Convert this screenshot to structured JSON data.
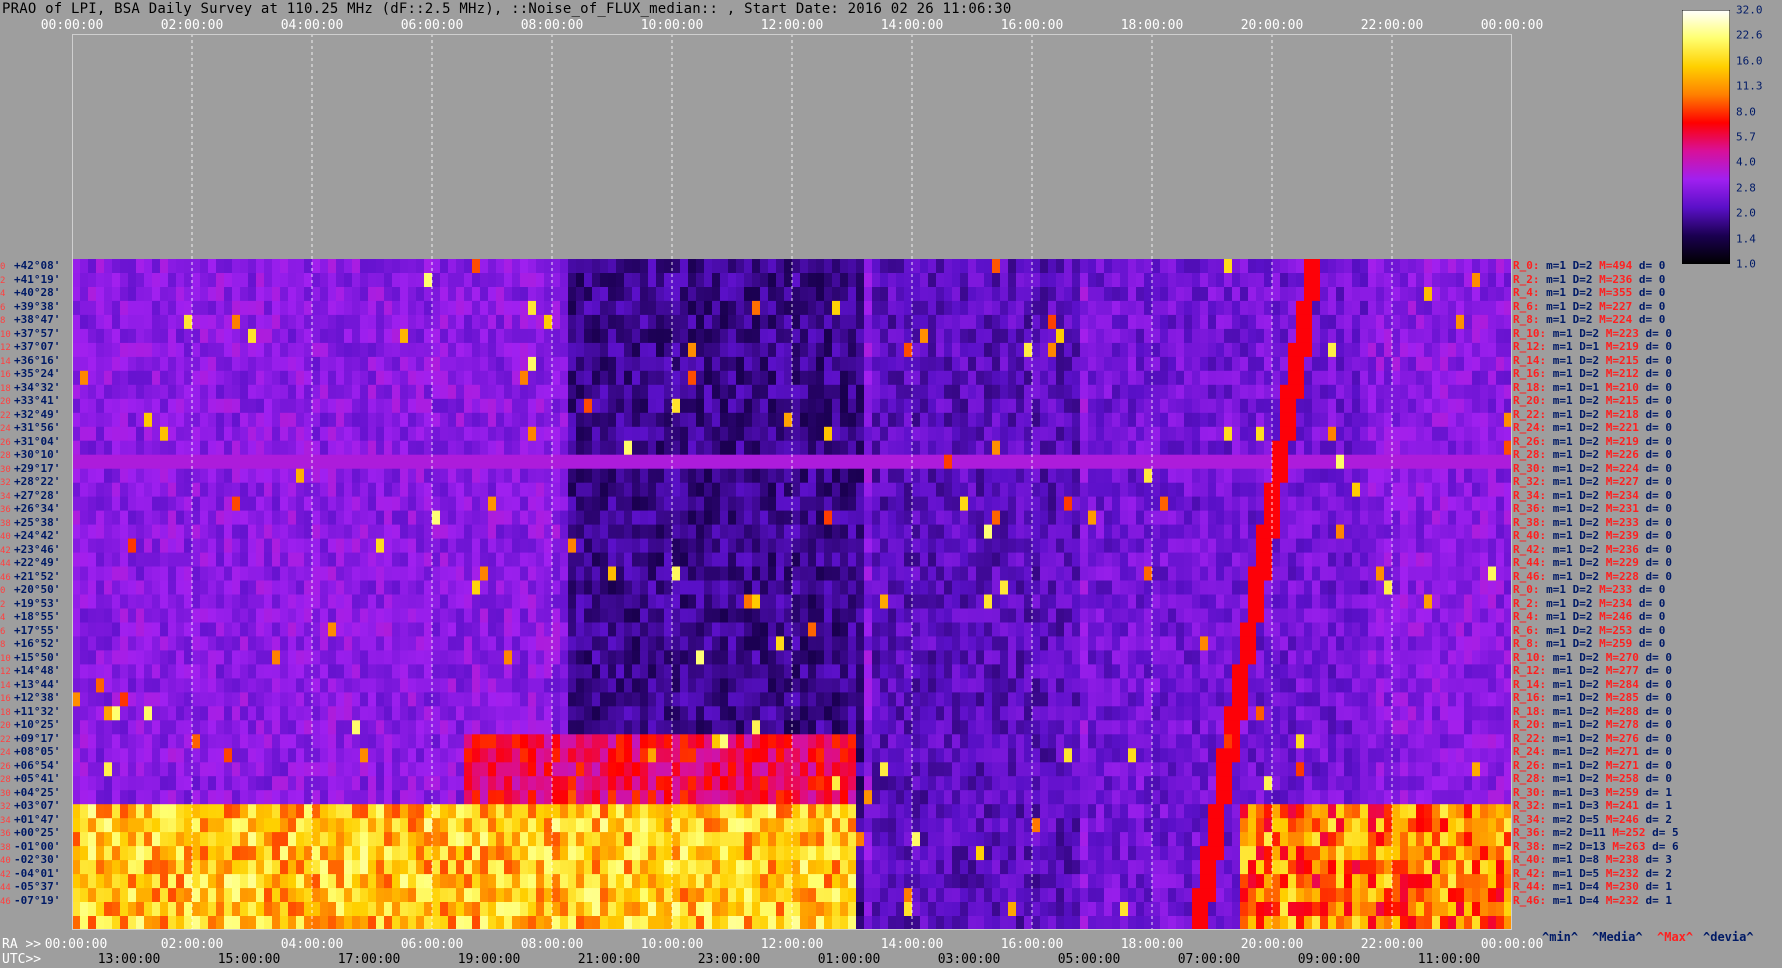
{
  "title": "PRAO of LPI, BSA Daily Survey at 110.25 MHz (dF::2.5 MHz), ::Noise_of_FLUX_median:: , Start Date: 2016 02 26 11:06:30",
  "top_axis": [
    "00:00:00",
    "02:00:00",
    "04:00:00",
    "06:00:00",
    "08:00:00",
    "10:00:00",
    "12:00:00",
    "14:00:00",
    "16:00:00",
    "18:00:00",
    "20:00:00",
    "22:00:00",
    "00:00:00"
  ],
  "bottom_axis_prefix": "RA >>",
  "bottom_axis": [
    "00:00:00",
    "02:00:00",
    "04:00:00",
    "06:00:00",
    "08:00:00",
    "10:00:00",
    "12:00:00",
    "14:00:00",
    "16:00:00",
    "18:00:00",
    "20:00:00",
    "22:00:00",
    "00:00:00"
  ],
  "utc_prefix": "UTC>>",
  "utc_axis": [
    "13:00:00",
    "15:00:00",
    "17:00:00",
    "19:00:00",
    "21:00:00",
    "23:00:00",
    "01:00:00",
    "03:00:00",
    "05:00:00",
    "07:00:00",
    "09:00:00",
    "11:00:00"
  ],
  "declinations": [
    {
      "idx": "0",
      "dec": "+42°08'"
    },
    {
      "idx": "2",
      "dec": "+41°19'"
    },
    {
      "idx": "4",
      "dec": "+40°28'"
    },
    {
      "idx": "6",
      "dec": "+39°38'"
    },
    {
      "idx": "8",
      "dec": "+38°47'"
    },
    {
      "idx": "10",
      "dec": "+37°57'"
    },
    {
      "idx": "12",
      "dec": "+37°07'"
    },
    {
      "idx": "14",
      "dec": "+36°16'"
    },
    {
      "idx": "16",
      "dec": "+35°24'"
    },
    {
      "idx": "18",
      "dec": "+34°32'"
    },
    {
      "idx": "20",
      "dec": "+33°41'"
    },
    {
      "idx": "22",
      "dec": "+32°49'"
    },
    {
      "idx": "24",
      "dec": "+31°56'"
    },
    {
      "idx": "26",
      "dec": "+31°04'"
    },
    {
      "idx": "28",
      "dec": "+30°10'"
    },
    {
      "idx": "30",
      "dec": "+29°17'"
    },
    {
      "idx": "32",
      "dec": "+28°22'"
    },
    {
      "idx": "34",
      "dec": "+27°28'"
    },
    {
      "idx": "36",
      "dec": "+26°34'"
    },
    {
      "idx": "38",
      "dec": "+25°38'"
    },
    {
      "idx": "40",
      "dec": "+24°42'"
    },
    {
      "idx": "42",
      "dec": "+23°46'"
    },
    {
      "idx": "44",
      "dec": "+22°49'"
    },
    {
      "idx": "46",
      "dec": "+21°52'"
    },
    {
      "idx": "0",
      "dec": "+20°50'"
    },
    {
      "idx": "2",
      "dec": "+19°53'"
    },
    {
      "idx": "4",
      "dec": "+18°55'"
    },
    {
      "idx": "6",
      "dec": "+17°55'"
    },
    {
      "idx": "8",
      "dec": "+16°52'"
    },
    {
      "idx": "10",
      "dec": "+15°50'"
    },
    {
      "idx": "12",
      "dec": "+14°48'"
    },
    {
      "idx": "14",
      "dec": "+13°44'"
    },
    {
      "idx": "16",
      "dec": "+12°38'"
    },
    {
      "idx": "18",
      "dec": "+11°32'"
    },
    {
      "idx": "20",
      "dec": "+10°25'"
    },
    {
      "idx": "22",
      "dec": "+09°17'"
    },
    {
      "idx": "24",
      "dec": "+08°05'"
    },
    {
      "idx": "26",
      "dec": "+06°54'"
    },
    {
      "idx": "28",
      "dec": "+05°41'"
    },
    {
      "idx": "30",
      "dec": "+04°25'"
    },
    {
      "idx": "32",
      "dec": "+03°07'"
    },
    {
      "idx": "34",
      "dec": "+01°47'"
    },
    {
      "idx": "36",
      "dec": "+00°25'"
    },
    {
      "idx": "38",
      "dec": "-01°00'"
    },
    {
      "idx": "40",
      "dec": "-02°30'"
    },
    {
      "idx": "42",
      "dec": "-04°01'"
    },
    {
      "idx": "44",
      "dec": "-05°37'"
    },
    {
      "idx": "46",
      "dec": "-07°19'"
    }
  ],
  "stats": [
    {
      "r": "R_0:",
      "m": "m=1",
      "D": "D=2",
      "M": "M=494",
      "d": "d= 0"
    },
    {
      "r": "R_2:",
      "m": "m=1",
      "D": "D=2",
      "M": "M=236",
      "d": "d= 0"
    },
    {
      "r": "R_4:",
      "m": "m=1",
      "D": "D=2",
      "M": "M=355",
      "d": "d= 0"
    },
    {
      "r": "R_6:",
      "m": "m=1",
      "D": "D=2",
      "M": "M=227",
      "d": "d= 0"
    },
    {
      "r": "R_8:",
      "m": "m=1",
      "D": "D=2",
      "M": "M=224",
      "d": "d= 0"
    },
    {
      "r": "R_10:",
      "m": "m=1",
      "D": "D=2",
      "M": "M=223",
      "d": "d= 0"
    },
    {
      "r": "R_12:",
      "m": "m=1",
      "D": "D=1",
      "M": "M=219",
      "d": "d= 0"
    },
    {
      "r": "R_14:",
      "m": "m=1",
      "D": "D=2",
      "M": "M=215",
      "d": "d= 0"
    },
    {
      "r": "R_16:",
      "m": "m=1",
      "D": "D=2",
      "M": "M=212",
      "d": "d= 0"
    },
    {
      "r": "R_18:",
      "m": "m=1",
      "D": "D=1",
      "M": "M=210",
      "d": "d= 0"
    },
    {
      "r": "R_20:",
      "m": "m=1",
      "D": "D=2",
      "M": "M=215",
      "d": "d= 0"
    },
    {
      "r": "R_22:",
      "m": "m=1",
      "D": "D=2",
      "M": "M=218",
      "d": "d= 0"
    },
    {
      "r": "R_24:",
      "m": "m=1",
      "D": "D=2",
      "M": "M=221",
      "d": "d= 0"
    },
    {
      "r": "R_26:",
      "m": "m=1",
      "D": "D=2",
      "M": "M=219",
      "d": "d= 0"
    },
    {
      "r": "R_28:",
      "m": "m=1",
      "D": "D=2",
      "M": "M=226",
      "d": "d= 0"
    },
    {
      "r": "R_30:",
      "m": "m=1",
      "D": "D=2",
      "M": "M=224",
      "d": "d= 0"
    },
    {
      "r": "R_32:",
      "m": "m=1",
      "D": "D=2",
      "M": "M=227",
      "d": "d= 0"
    },
    {
      "r": "R_34:",
      "m": "m=1",
      "D": "D=2",
      "M": "M=234",
      "d": "d= 0"
    },
    {
      "r": "R_36:",
      "m": "m=1",
      "D": "D=2",
      "M": "M=231",
      "d": "d= 0"
    },
    {
      "r": "R_38:",
      "m": "m=1",
      "D": "D=2",
      "M": "M=233",
      "d": "d= 0"
    },
    {
      "r": "R_40:",
      "m": "m=1",
      "D": "D=2",
      "M": "M=239",
      "d": "d= 0"
    },
    {
      "r": "R_42:",
      "m": "m=1",
      "D": "D=2",
      "M": "M=236",
      "d": "d= 0"
    },
    {
      "r": "R_44:",
      "m": "m=1",
      "D": "D=2",
      "M": "M=229",
      "d": "d= 0"
    },
    {
      "r": "R_46:",
      "m": "m=1",
      "D": "D=2",
      "M": "M=228",
      "d": "d= 0"
    },
    {
      "r": "R_0:",
      "m": "m=1",
      "D": "D=2",
      "M": "M=233",
      "d": "d= 0"
    },
    {
      "r": "R_2:",
      "m": "m=1",
      "D": "D=2",
      "M": "M=234",
      "d": "d= 0"
    },
    {
      "r": "R_4:",
      "m": "m=1",
      "D": "D=2",
      "M": "M=246",
      "d": "d= 0"
    },
    {
      "r": "R_6:",
      "m": "m=1",
      "D": "D=2",
      "M": "M=253",
      "d": "d= 0"
    },
    {
      "r": "R_8:",
      "m": "m=1",
      "D": "D=2",
      "M": "M=259",
      "d": "d= 0"
    },
    {
      "r": "R_10:",
      "m": "m=1",
      "D": "D=2",
      "M": "M=270",
      "d": "d= 0"
    },
    {
      "r": "R_12:",
      "m": "m=1",
      "D": "D=2",
      "M": "M=277",
      "d": "d= 0"
    },
    {
      "r": "R_14:",
      "m": "m=1",
      "D": "D=2",
      "M": "M=284",
      "d": "d= 0"
    },
    {
      "r": "R_16:",
      "m": "m=1",
      "D": "D=2",
      "M": "M=285",
      "d": "d= 0"
    },
    {
      "r": "R_18:",
      "m": "m=1",
      "D": "D=2",
      "M": "M=288",
      "d": "d= 0"
    },
    {
      "r": "R_20:",
      "m": "m=1",
      "D": "D=2",
      "M": "M=278",
      "d": "d= 0"
    },
    {
      "r": "R_22:",
      "m": "m=1",
      "D": "D=2",
      "M": "M=276",
      "d": "d= 0"
    },
    {
      "r": "R_24:",
      "m": "m=1",
      "D": "D=2",
      "M": "M=271",
      "d": "d= 0"
    },
    {
      "r": "R_26:",
      "m": "m=1",
      "D": "D=2",
      "M": "M=271",
      "d": "d= 0"
    },
    {
      "r": "R_28:",
      "m": "m=1",
      "D": "D=2",
      "M": "M=258",
      "d": "d= 0"
    },
    {
      "r": "R_30:",
      "m": "m=1",
      "D": "D=3",
      "M": "M=259",
      "d": "d= 1"
    },
    {
      "r": "R_32:",
      "m": "m=1",
      "D": "D=3",
      "M": "M=241",
      "d": "d= 1"
    },
    {
      "r": "R_34:",
      "m": "m=2",
      "D": "D=5",
      "M": "M=246",
      "d": "d= 2"
    },
    {
      "r": "R_36:",
      "m": "m=2",
      "D": "D=11",
      "M": "M=252",
      "d": "d= 5"
    },
    {
      "r": "R_38:",
      "m": "m=2",
      "D": "D=13",
      "M": "M=263",
      "d": "d= 6"
    },
    {
      "r": "R_40:",
      "m": "m=1",
      "D": "D=8",
      "M": "M=238",
      "d": "d= 3"
    },
    {
      "r": "R_42:",
      "m": "m=1",
      "D": "D=5",
      "M": "M=232",
      "d": "d= 2"
    },
    {
      "r": "R_44:",
      "m": "m=1",
      "D": "D=4",
      "M": "M=230",
      "d": "d= 1"
    },
    {
      "r": "R_46:",
      "m": "m=1",
      "D": "D=4",
      "M": "M=232",
      "d": "d= 1"
    }
  ],
  "footer_labels": {
    "min": "^min^",
    "media": "^Media^",
    "max": "^Max^",
    "devia": "^devia^"
  },
  "colorbar": {
    "ticks": [
      "32.0",
      "22.6",
      "16.0",
      "11.3",
      "8.0",
      "5.7",
      "4.0",
      "2.8",
      "2.0",
      "1.4",
      "1.0"
    ],
    "stops": [
      "#000000",
      "#1a0050",
      "#5a10c8",
      "#a020f0",
      "#d8109a",
      "#ff0000",
      "#ff8000",
      "#ffd000",
      "#ffff70",
      "#ffffff"
    ]
  },
  "colors": {
    "background": "#9e9e9e",
    "axis_text": "#ffffff",
    "label_red": "#ff2020",
    "label_navy": "#001a66"
  }
}
